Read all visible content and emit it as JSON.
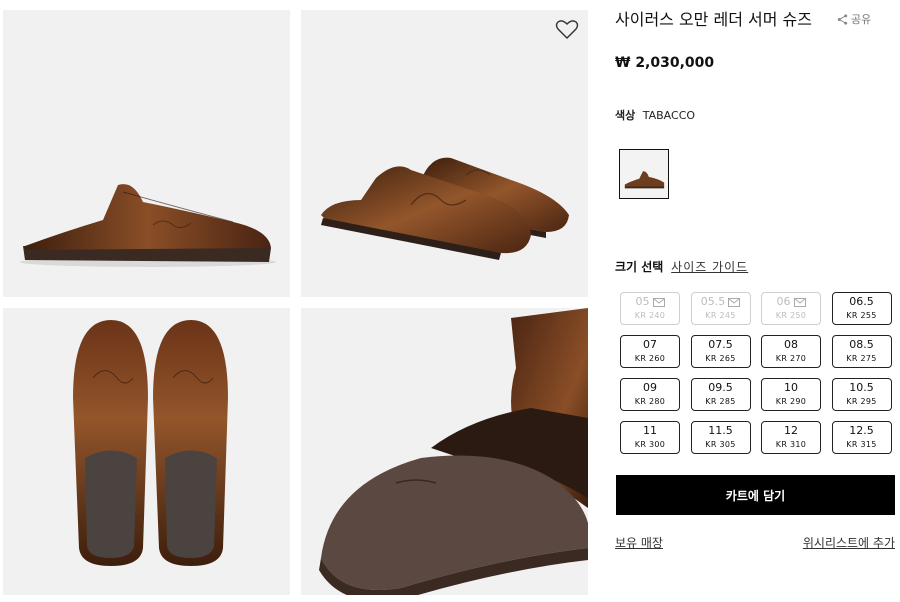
{
  "product": {
    "title": "사이러스 오만 레더 서머 슈즈",
    "price": "₩ 2,030,000",
    "share_label": "공유",
    "color_label": "색상",
    "color_value": "TABACCO",
    "leather_color": "#6e3c1e"
  },
  "gallery": {
    "images": [
      {
        "icon": "shoe-side-view-image"
      },
      {
        "icon": "shoe-pair-angle-image"
      },
      {
        "icon": "shoe-pair-top-view-image"
      },
      {
        "icon": "shoe-interior-closeup-image"
      }
    ],
    "wishlist_icon": "heart-icon"
  },
  "size_section": {
    "label": "크기 선택",
    "guide_link": "사이즈 가이드",
    "sizes": [
      {
        "eu": "05",
        "kr": "KR 240",
        "available": false
      },
      {
        "eu": "05.5",
        "kr": "KR 245",
        "available": false
      },
      {
        "eu": "06",
        "kr": "KR 250",
        "available": false
      },
      {
        "eu": "06.5",
        "kr": "KR 255",
        "available": true
      },
      {
        "eu": "07",
        "kr": "KR 260",
        "available": true
      },
      {
        "eu": "07.5",
        "kr": "KR 265",
        "available": true
      },
      {
        "eu": "08",
        "kr": "KR 270",
        "available": true
      },
      {
        "eu": "08.5",
        "kr": "KR 275",
        "available": true
      },
      {
        "eu": "09",
        "kr": "KR 280",
        "available": true
      },
      {
        "eu": "09.5",
        "kr": "KR 285",
        "available": true
      },
      {
        "eu": "10",
        "kr": "KR 290",
        "available": true
      },
      {
        "eu": "10.5",
        "kr": "KR 295",
        "available": true
      },
      {
        "eu": "11",
        "kr": "KR 300",
        "available": true
      },
      {
        "eu": "11.5",
        "kr": "KR 305",
        "available": true
      },
      {
        "eu": "12",
        "kr": "KR 310",
        "available": true
      },
      {
        "eu": "12.5",
        "kr": "KR 315",
        "available": true
      }
    ]
  },
  "actions": {
    "add_to_cart": "카트에 담기",
    "store_stock": "보유 매장",
    "add_to_wishlist": "위시리스트에 추가"
  }
}
